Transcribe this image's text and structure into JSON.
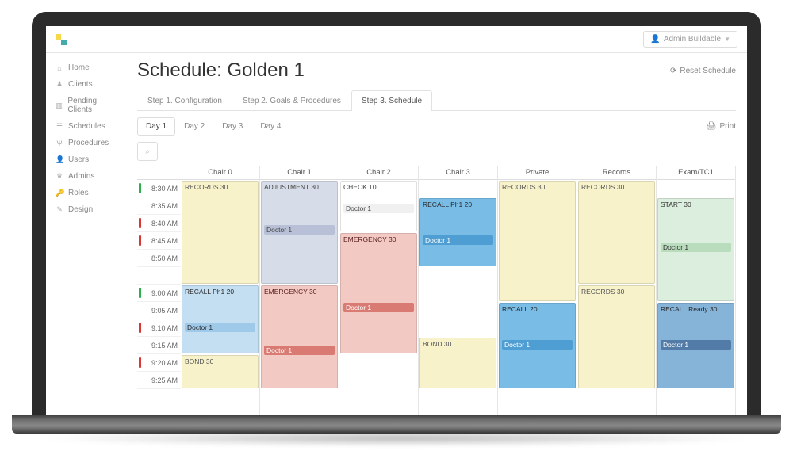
{
  "header": {
    "user_label": "Admin Buildable"
  },
  "sidebar": {
    "items": [
      {
        "icon": "⌂",
        "label": "Home"
      },
      {
        "icon": "♟",
        "label": "Clients"
      },
      {
        "icon": "▥",
        "label": "Pending Clients"
      },
      {
        "icon": "☰",
        "label": "Schedules"
      },
      {
        "icon": "Ѱ",
        "label": "Procedures"
      },
      {
        "icon": "👤",
        "label": "Users"
      },
      {
        "icon": "♛",
        "label": "Admins"
      },
      {
        "icon": "🔑",
        "label": "Roles"
      },
      {
        "icon": "✎",
        "label": "Design"
      }
    ]
  },
  "page": {
    "title": "Schedule: Golden 1",
    "reset_label": "Reset Schedule",
    "print_label": "Print",
    "step_tabs": [
      "Step 1. Configuration",
      "Step 2. Goals & Procedures",
      "Step 3. Schedule"
    ],
    "active_step": 2,
    "day_tabs": [
      "Day 1",
      "Day 2",
      "Day 3",
      "Day 4"
    ],
    "active_day": 0
  },
  "schedule": {
    "time_slots": [
      {
        "t": "8:30 AM",
        "m": "green"
      },
      {
        "t": "8:35 AM",
        "m": ""
      },
      {
        "t": "8:40 AM",
        "m": "red"
      },
      {
        "t": "8:45 AM",
        "m": "red"
      },
      {
        "t": "8:50 AM",
        "m": ""
      },
      {
        "t": "",
        "m": ""
      },
      {
        "t": "9:00 AM",
        "m": "green"
      },
      {
        "t": "9:05 AM",
        "m": ""
      },
      {
        "t": "9:10 AM",
        "m": "red"
      },
      {
        "t": "9:15 AM",
        "m": ""
      },
      {
        "t": "9:20 AM",
        "m": "red"
      },
      {
        "t": "9:25 AM",
        "m": ""
      }
    ],
    "columns": [
      {
        "title": "Chair 0",
        "appts": [
          {
            "start": 0,
            "span": 6,
            "color": "yellow",
            "title": "RECORDS 30",
            "sub": ""
          },
          {
            "start": 6,
            "span": 4,
            "color": "blue-light",
            "title": "RECALL Ph1 20",
            "sub": "Doctor 1"
          },
          {
            "start": 10,
            "span": 2,
            "color": "yellow",
            "title": "BOND 30",
            "sub": ""
          }
        ]
      },
      {
        "title": "Chair 1",
        "appts": [
          {
            "start": 0,
            "span": 6,
            "color": "bluegray",
            "title": "ADJUSTMENT 30",
            "sub": "Doctor 1"
          },
          {
            "start": 6,
            "span": 6,
            "color": "red-light",
            "title": "EMERGENCY 30",
            "sub": "Doctor 1"
          }
        ]
      },
      {
        "title": "Chair 2",
        "appts": [
          {
            "start": 0,
            "span": 3,
            "color": "white",
            "title": "CHECK 10",
            "sub": "Doctor 1"
          },
          {
            "start": 3,
            "span": 7,
            "color": "red-light",
            "title": "EMERGENCY 30",
            "sub": "Doctor 1"
          }
        ]
      },
      {
        "title": "Chair 3",
        "appts": [
          {
            "start": 1,
            "span": 4,
            "color": "blue-med",
            "title": "RECALL Ph1 20",
            "sub": "Doctor 1"
          },
          {
            "start": 9,
            "span": 3,
            "color": "yellow",
            "title": "BOND 30",
            "sub": ""
          }
        ]
      },
      {
        "title": "Private",
        "appts": [
          {
            "start": 0,
            "span": 7,
            "color": "yellow",
            "title": "RECORDS 30",
            "sub": ""
          },
          {
            "start": 7,
            "span": 5,
            "color": "blue-med",
            "title": "RECALL 20",
            "sub": "Doctor 1"
          }
        ]
      },
      {
        "title": "Records",
        "appts": [
          {
            "start": 0,
            "span": 6,
            "color": "yellow",
            "title": "RECORDS 30",
            "sub": ""
          },
          {
            "start": 6,
            "span": 6,
            "color": "yellow",
            "title": "RECORDS 30",
            "sub": ""
          }
        ]
      },
      {
        "title": "Exam/TC1",
        "appts": [
          {
            "start": 1,
            "span": 6,
            "color": "green-light",
            "title": "START 30",
            "sub": "Doctor 1"
          },
          {
            "start": 7,
            "span": 5,
            "color": "blue-dark",
            "title": "RECALL Ready 30",
            "sub": "Doctor 1"
          }
        ]
      }
    ]
  }
}
